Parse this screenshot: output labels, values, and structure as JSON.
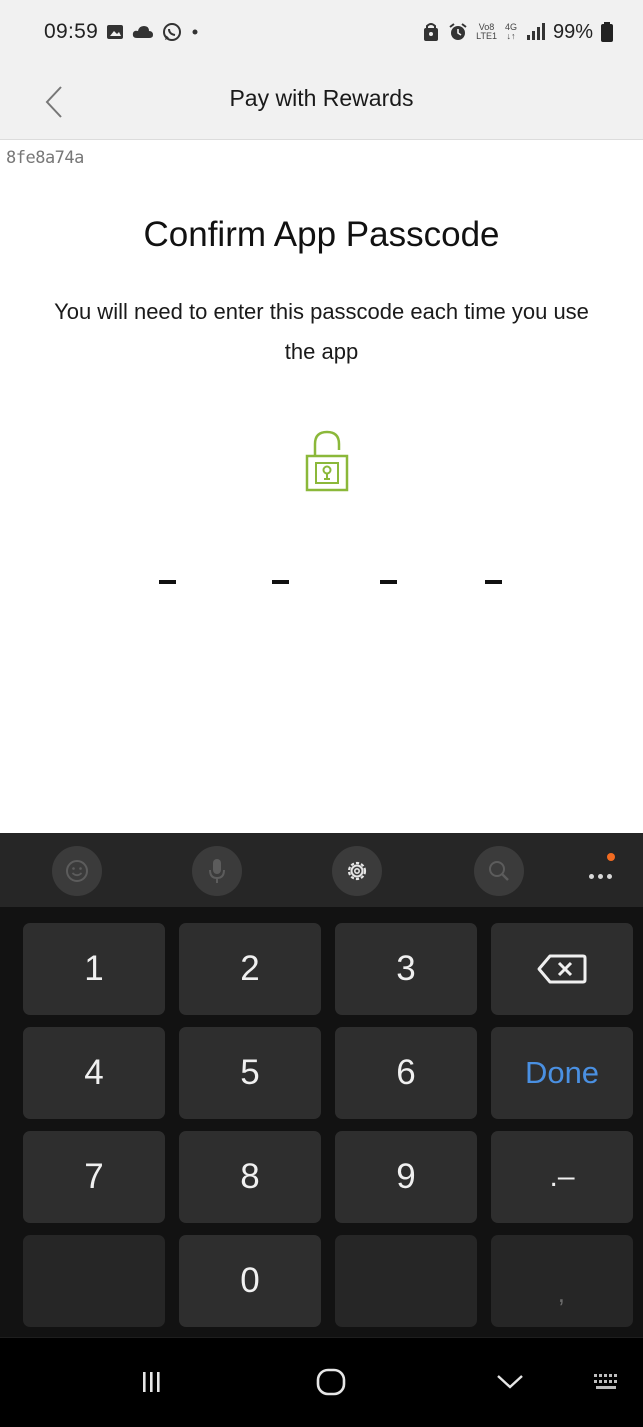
{
  "status_bar": {
    "time": "09:59",
    "left_icons": [
      "gallery-icon",
      "cloud-icon",
      "whatsapp-icon",
      "dot-icon"
    ],
    "right_icons": [
      "alarm-lock-icon",
      "alarm-icon",
      "volte-icon",
      "4g-icon",
      "signal-icon"
    ],
    "volte_line1": "Vo8",
    "volte_line2": "LTE1",
    "network_type": "4G",
    "battery_percent": "99%"
  },
  "header": {
    "title": "Pay with Rewards",
    "back_icon": "chevron-left-icon"
  },
  "debug_id": "8fe8a74a",
  "passcode": {
    "title": "Confirm App Passcode",
    "instruction": "You will need to enter this passcode each time you use the app",
    "lock_icon_color": "#8bb83a",
    "digit_count": 4
  },
  "keyboard": {
    "toolbar_icons": [
      "emoji-icon",
      "microphone-icon",
      "settings-icon",
      "search-icon",
      "more-icon"
    ],
    "notification_dot_color": "#f26b21",
    "keys": {
      "k1": "1",
      "k2": "2",
      "k3": "3",
      "k4": "4",
      "k5": "5",
      "k6": "6",
      "k7": "7",
      "k8": "8",
      "k9": "9",
      "k0": "0",
      "done": "Done",
      "period": ".–",
      "comma": ","
    },
    "done_color": "#4a90e2"
  },
  "nav_bar": {
    "icons": [
      "recents-icon",
      "home-icon",
      "hide-keyboard-icon",
      "keyboard-icon"
    ]
  }
}
